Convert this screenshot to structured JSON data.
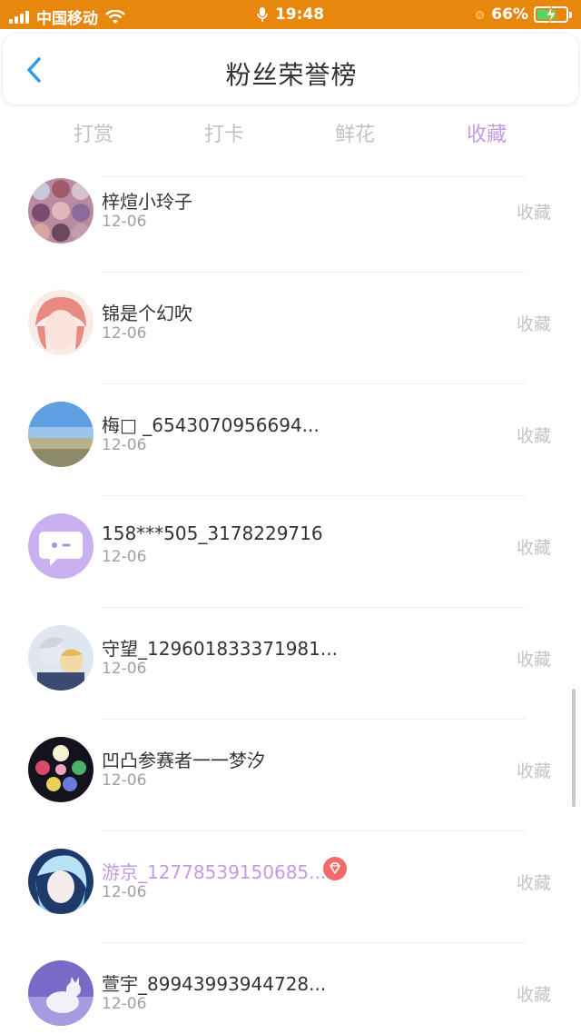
{
  "status_bar": {
    "carrier": "中国移动",
    "time": "19:48",
    "battery": "66%",
    "battery_level": 0.66
  },
  "header": {
    "title": "粉丝荣誉榜",
    "back_icon": "chevron-left-icon",
    "accent_color": "#2e9be6"
  },
  "tabs": [
    {
      "label": "打赏",
      "active": false
    },
    {
      "label": "打卡",
      "active": false
    },
    {
      "label": "鲜花",
      "active": false
    },
    {
      "label": "收藏",
      "active": true
    }
  ],
  "fans": [
    {
      "name": "梓煊小玲子",
      "date": "12-06",
      "type": "收藏",
      "vip": false
    },
    {
      "name": "锦是个幻吹",
      "date": "12-06",
      "type": "收藏",
      "vip": false
    },
    {
      "name": "梅□ _6543070956694...",
      "date": "12-06",
      "type": "收藏",
      "vip": false
    },
    {
      "name": "158***505_3178229716",
      "date": "12-06",
      "type": "收藏",
      "vip": false
    },
    {
      "name": "守望_129601833371981...",
      "date": "12-06",
      "type": "收藏",
      "vip": false
    },
    {
      "name": "凹凸参赛者一一梦汐",
      "date": "12-06",
      "type": "收藏",
      "vip": false
    },
    {
      "name": "游京_12778539150685...",
      "date": "12-06",
      "type": "收藏",
      "vip": true
    },
    {
      "name": "萱宇_89943993944728...",
      "date": "12-06",
      "type": "收藏",
      "vip": false
    }
  ],
  "colors": {
    "status_bar": "#e8870e",
    "active_tab": "#c39be0",
    "vip_name": "#c39be0",
    "gem_badge": "#f26b6b"
  }
}
